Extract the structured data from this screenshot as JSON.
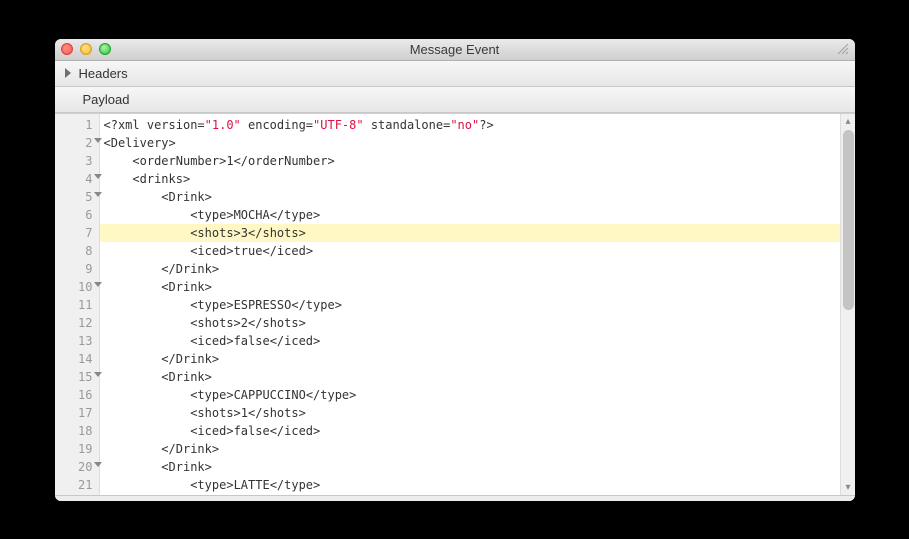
{
  "window": {
    "title": "Message Event"
  },
  "sections": {
    "headers": "Headers",
    "payload": "Payload"
  },
  "editor": {
    "highlight_line": 7,
    "lines": [
      {
        "n": 1,
        "fold": false,
        "indent": 0,
        "segs": [
          {
            "c": "c-pi",
            "t": "<?xml "
          },
          {
            "c": "c-txt",
            "t": "version="
          },
          {
            "c": "c-str",
            "t": "\"1.0\""
          },
          {
            "c": "c-txt",
            "t": " encoding="
          },
          {
            "c": "c-str",
            "t": "\"UTF-8\""
          },
          {
            "c": "c-txt",
            "t": " standalone="
          },
          {
            "c": "c-str",
            "t": "\"no\""
          },
          {
            "c": "c-pi",
            "t": "?>"
          }
        ]
      },
      {
        "n": 2,
        "fold": true,
        "indent": 0,
        "segs": [
          {
            "c": "c-tag",
            "t": "<Delivery>"
          }
        ]
      },
      {
        "n": 3,
        "fold": false,
        "indent": 1,
        "segs": [
          {
            "c": "c-tag",
            "t": "<orderNumber>"
          },
          {
            "c": "c-txt",
            "t": "1"
          },
          {
            "c": "c-tag",
            "t": "</orderNumber>"
          }
        ]
      },
      {
        "n": 4,
        "fold": true,
        "indent": 1,
        "segs": [
          {
            "c": "c-tag",
            "t": "<drinks>"
          }
        ]
      },
      {
        "n": 5,
        "fold": true,
        "indent": 2,
        "segs": [
          {
            "c": "c-tag",
            "t": "<Drink>"
          }
        ]
      },
      {
        "n": 6,
        "fold": false,
        "indent": 3,
        "segs": [
          {
            "c": "c-tag",
            "t": "<type>"
          },
          {
            "c": "c-txt",
            "t": "MOCHA"
          },
          {
            "c": "c-tag",
            "t": "</type>"
          }
        ]
      },
      {
        "n": 7,
        "fold": false,
        "indent": 3,
        "segs": [
          {
            "c": "c-tag",
            "t": "<shots>"
          },
          {
            "c": "c-txt",
            "t": "3"
          },
          {
            "c": "c-tag",
            "t": "</shots>"
          }
        ]
      },
      {
        "n": 8,
        "fold": false,
        "indent": 3,
        "segs": [
          {
            "c": "c-tag",
            "t": "<iced>"
          },
          {
            "c": "c-txt",
            "t": "true"
          },
          {
            "c": "c-tag",
            "t": "</iced>"
          }
        ]
      },
      {
        "n": 9,
        "fold": false,
        "indent": 2,
        "segs": [
          {
            "c": "c-tag",
            "t": "</Drink>"
          }
        ]
      },
      {
        "n": 10,
        "fold": true,
        "indent": 2,
        "segs": [
          {
            "c": "c-tag",
            "t": "<Drink>"
          }
        ]
      },
      {
        "n": 11,
        "fold": false,
        "indent": 3,
        "segs": [
          {
            "c": "c-tag",
            "t": "<type>"
          },
          {
            "c": "c-txt",
            "t": "ESPRESSO"
          },
          {
            "c": "c-tag",
            "t": "</type>"
          }
        ]
      },
      {
        "n": 12,
        "fold": false,
        "indent": 3,
        "segs": [
          {
            "c": "c-tag",
            "t": "<shots>"
          },
          {
            "c": "c-txt",
            "t": "2"
          },
          {
            "c": "c-tag",
            "t": "</shots>"
          }
        ]
      },
      {
        "n": 13,
        "fold": false,
        "indent": 3,
        "segs": [
          {
            "c": "c-tag",
            "t": "<iced>"
          },
          {
            "c": "c-txt",
            "t": "false"
          },
          {
            "c": "c-tag",
            "t": "</iced>"
          }
        ]
      },
      {
        "n": 14,
        "fold": false,
        "indent": 2,
        "segs": [
          {
            "c": "c-tag",
            "t": "</Drink>"
          }
        ]
      },
      {
        "n": 15,
        "fold": true,
        "indent": 2,
        "segs": [
          {
            "c": "c-tag",
            "t": "<Drink>"
          }
        ]
      },
      {
        "n": 16,
        "fold": false,
        "indent": 3,
        "segs": [
          {
            "c": "c-tag",
            "t": "<type>"
          },
          {
            "c": "c-txt",
            "t": "CAPPUCCINO"
          },
          {
            "c": "c-tag",
            "t": "</type>"
          }
        ]
      },
      {
        "n": 17,
        "fold": false,
        "indent": 3,
        "segs": [
          {
            "c": "c-tag",
            "t": "<shots>"
          },
          {
            "c": "c-txt",
            "t": "1"
          },
          {
            "c": "c-tag",
            "t": "</shots>"
          }
        ]
      },
      {
        "n": 18,
        "fold": false,
        "indent": 3,
        "segs": [
          {
            "c": "c-tag",
            "t": "<iced>"
          },
          {
            "c": "c-txt",
            "t": "false"
          },
          {
            "c": "c-tag",
            "t": "</iced>"
          }
        ]
      },
      {
        "n": 19,
        "fold": false,
        "indent": 2,
        "segs": [
          {
            "c": "c-tag",
            "t": "</Drink>"
          }
        ]
      },
      {
        "n": 20,
        "fold": true,
        "indent": 2,
        "segs": [
          {
            "c": "c-tag",
            "t": "<Drink>"
          }
        ]
      },
      {
        "n": 21,
        "fold": false,
        "indent": 3,
        "segs": [
          {
            "c": "c-tag",
            "t": "<type>"
          },
          {
            "c": "c-txt",
            "t": "LATTE"
          },
          {
            "c": "c-tag",
            "t": "</type>"
          }
        ]
      }
    ]
  }
}
